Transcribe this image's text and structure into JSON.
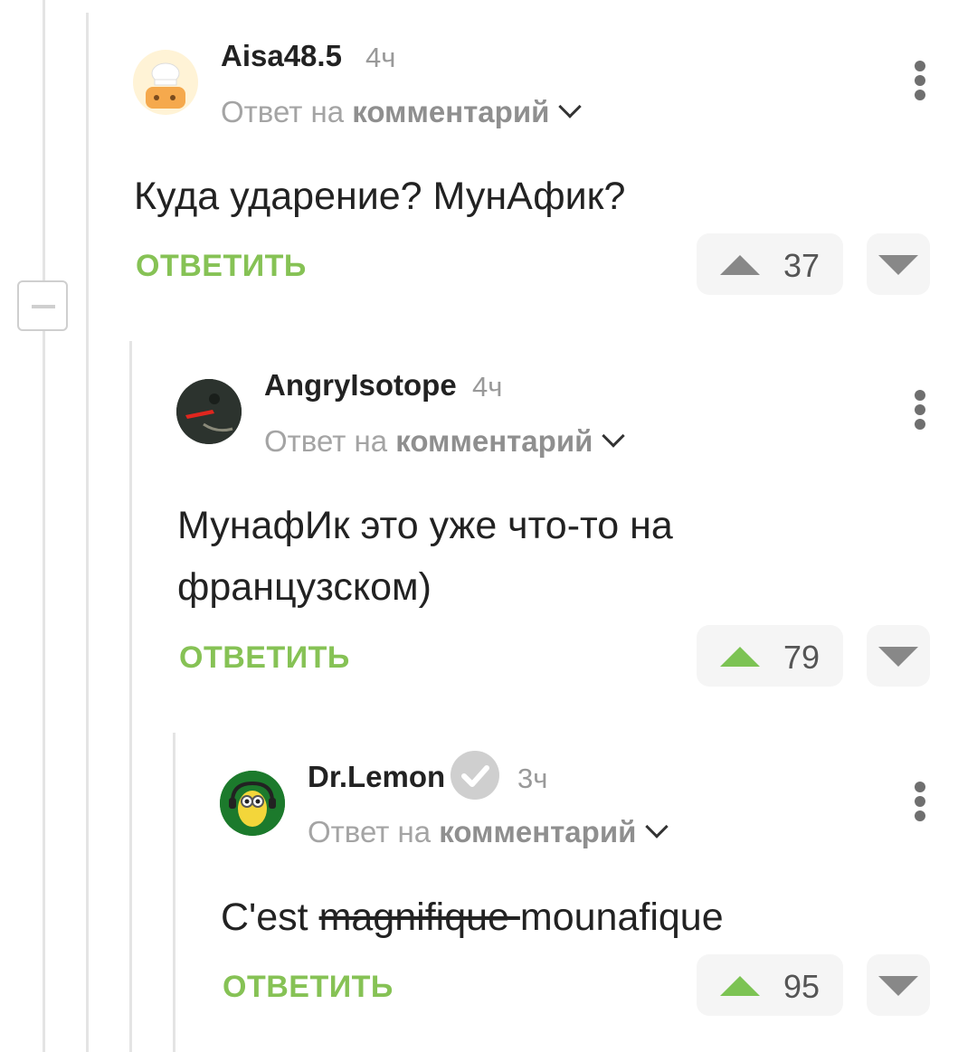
{
  "comments": [
    {
      "username": "Aisa48.5",
      "time": "4ч",
      "reply_prefix": "Ответ на",
      "reply_target": "комментарий",
      "text": "Куда ударение? МунАфик?",
      "reply_label": "ОТВЕТИТЬ",
      "score": "37",
      "upvoted": false
    },
    {
      "username": "AngryIsotope",
      "time": "4ч",
      "reply_prefix": "Ответ на",
      "reply_target": "комментарий",
      "text": "МунафИк это уже что-то на французском)",
      "reply_label": "ОТВЕТИТЬ",
      "score": "79",
      "upvoted": true
    },
    {
      "username": "Dr.Lemon",
      "time": "3ч",
      "reply_prefix": "Ответ на",
      "reply_target": "комментарий",
      "text_plain_start": "C'est ",
      "text_struck": "magnifique ",
      "text_plain_end": "mounafique",
      "reply_label": "ОТВЕТИТЬ",
      "score": "95",
      "upvoted": true,
      "verified": true
    }
  ],
  "colors": {
    "accent_green": "#86c255",
    "upvote_green": "#7cc353",
    "thread_line": "#e4e4e4"
  },
  "icons": {
    "collapse": "minus-square-icon",
    "more": "kebab-menu-icon",
    "upvote": "triangle-up-icon",
    "downvote": "triangle-down-icon",
    "chevron": "chevron-down-icon",
    "verified": "checkmark-badge-icon"
  }
}
